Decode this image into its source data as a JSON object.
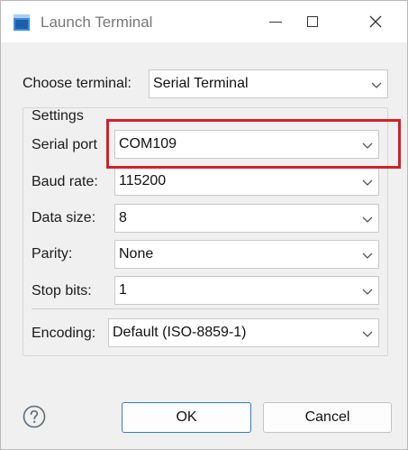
{
  "window": {
    "title": "Launch Terminal",
    "controls": {
      "minimize": "minimize-icon",
      "maximize": "maximize-icon",
      "close": "close-icon"
    }
  },
  "choose_terminal": {
    "label": "Choose terminal:",
    "value": "Serial Terminal"
  },
  "settings": {
    "title": "Settings",
    "serial_port": {
      "label": "Serial port",
      "value": "COM109"
    },
    "baud_rate": {
      "label": "Baud rate:",
      "value": "115200"
    },
    "data_size": {
      "label": "Data size:",
      "value": "8"
    },
    "parity": {
      "label": "Parity:",
      "value": "None"
    },
    "stop_bits": {
      "label": "Stop bits:",
      "value": "1"
    },
    "encoding": {
      "label": "Encoding:",
      "value": "Default (ISO-8859-1)"
    }
  },
  "buttons": {
    "ok": "OK",
    "cancel": "Cancel"
  },
  "icons": {
    "app": "terminal-app-icon",
    "help": "help-icon",
    "dropdown": "chevron-down-icon"
  },
  "colors": {
    "highlight": "#d71e28",
    "default_button_border": "#2a7fd4"
  }
}
